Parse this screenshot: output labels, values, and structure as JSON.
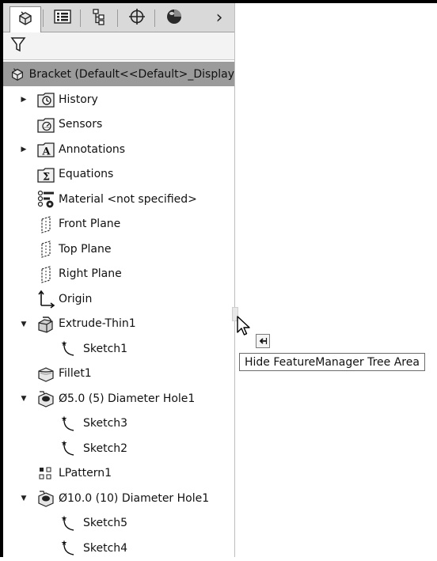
{
  "tabs": [
    {
      "name": "FeatureManager design tree",
      "icon": "featuremanager-icon"
    },
    {
      "name": "PropertyManager",
      "icon": "propertymanager-icon"
    },
    {
      "name": "ConfigurationManager",
      "icon": "configurationmanager-icon"
    },
    {
      "name": "DimXpertManager",
      "icon": "dimxpert-icon"
    },
    {
      "name": "DisplayManager",
      "icon": "displaymanager-icon"
    }
  ],
  "tab_more_glyph": "›",
  "filter_icon": "filter-icon",
  "root": {
    "label": "Bracket  (Default<<Default>_Display",
    "icon": "part-icon"
  },
  "tree": [
    {
      "label": "History",
      "icon": "history-folder-icon",
      "expander": "▶",
      "level": 0
    },
    {
      "label": "Sensors",
      "icon": "sensors-folder-icon",
      "expander": "",
      "level": 0
    },
    {
      "label": "Annotations",
      "icon": "annotations-folder-icon",
      "expander": "▶",
      "level": 0
    },
    {
      "label": "Equations",
      "icon": "equations-folder-icon",
      "expander": "",
      "level": 0
    },
    {
      "label": "Material <not specified>",
      "icon": "material-icon",
      "expander": "",
      "level": 0
    },
    {
      "label": "Front Plane",
      "icon": "plane-icon",
      "expander": "",
      "level": 0
    },
    {
      "label": "Top Plane",
      "icon": "plane-icon",
      "expander": "",
      "level": 0
    },
    {
      "label": "Right Plane",
      "icon": "plane-icon",
      "expander": "",
      "level": 0
    },
    {
      "label": "Origin",
      "icon": "origin-icon",
      "expander": "",
      "level": 0
    },
    {
      "label": "Extrude-Thin1",
      "icon": "extrude-thin-icon",
      "expander": "▼",
      "level": 0
    },
    {
      "label": "Sketch1",
      "icon": "sketch-icon",
      "expander": "",
      "level": 1
    },
    {
      "label": "Fillet1",
      "icon": "fillet-icon",
      "expander": "",
      "level": 0
    },
    {
      "label": "Ø5.0 (5) Diameter Hole1",
      "icon": "hole-icon",
      "expander": "▼",
      "level": 0
    },
    {
      "label": "Sketch3",
      "icon": "sketch-icon",
      "expander": "",
      "level": 1
    },
    {
      "label": "Sketch2",
      "icon": "sketch-icon",
      "expander": "",
      "level": 1
    },
    {
      "label": "LPattern1",
      "icon": "linear-pattern-icon",
      "expander": "",
      "level": 0
    },
    {
      "label": "Ø10.0 (10) Diameter Hole1",
      "icon": "hole-icon",
      "expander": "▼",
      "level": 0
    },
    {
      "label": "Sketch5",
      "icon": "sketch-icon",
      "expander": "",
      "level": 1
    },
    {
      "label": "Sketch4",
      "icon": "sketch-icon",
      "expander": "",
      "level": 1
    }
  ],
  "tooltip": {
    "text": "Hide FeatureManager Tree Area"
  },
  "hide_button_icon": "collapse-arrow-icon",
  "cursor_icon": "mouse-pointer-icon"
}
